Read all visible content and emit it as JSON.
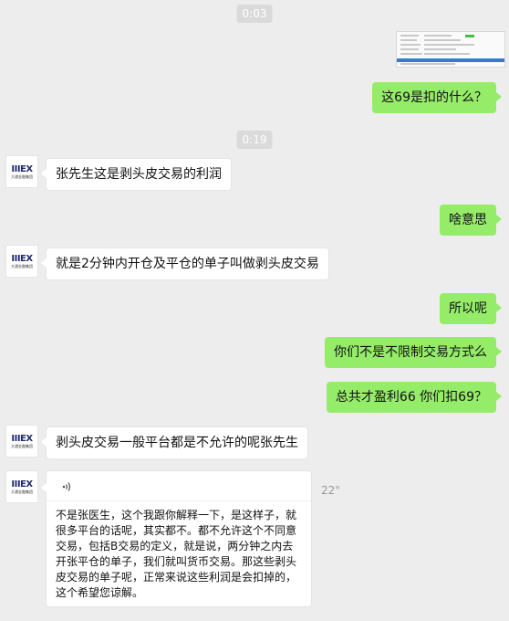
{
  "timestamps": [
    "0:03",
    "0:19"
  ],
  "avatar": {
    "logo": "IIIEX",
    "company": "大通金融集团"
  },
  "messages": [
    {
      "side": "me",
      "text": "这69是扣的什么？"
    },
    {
      "side": "them",
      "text": "张先生这是剥头皮交易的利润"
    },
    {
      "side": "me",
      "text": "啥意思"
    },
    {
      "side": "them",
      "text": "就是2分钟内开仓及平仓的单子叫做剥头皮交易"
    },
    {
      "side": "me",
      "text": "所以呢"
    },
    {
      "side": "me",
      "text": "你们不是不限制交易方式么"
    },
    {
      "side": "me",
      "text": "总共才盈利66  你们扣69？"
    },
    {
      "side": "them",
      "text": "剥头皮交易一般平台都是不允许的呢张先生"
    }
  ],
  "voice": {
    "duration": "22\"",
    "transcript": "不是张医生，这个我跟你解释一下，是这样子，就很多平台的话呢，其实都不。都不允许这个不同意交易，包括B交易的定义，就是说，两分钟之内去开张平仓的单子，我们就叫货币交易。那这些剥头皮交易的单子呢，正常来说这些利润是会扣掉的，这个希望您谅解。"
  },
  "colors": {
    "background": "#ededed",
    "my_bubble": "#95ec69",
    "their_bubble": "#ffffff"
  }
}
